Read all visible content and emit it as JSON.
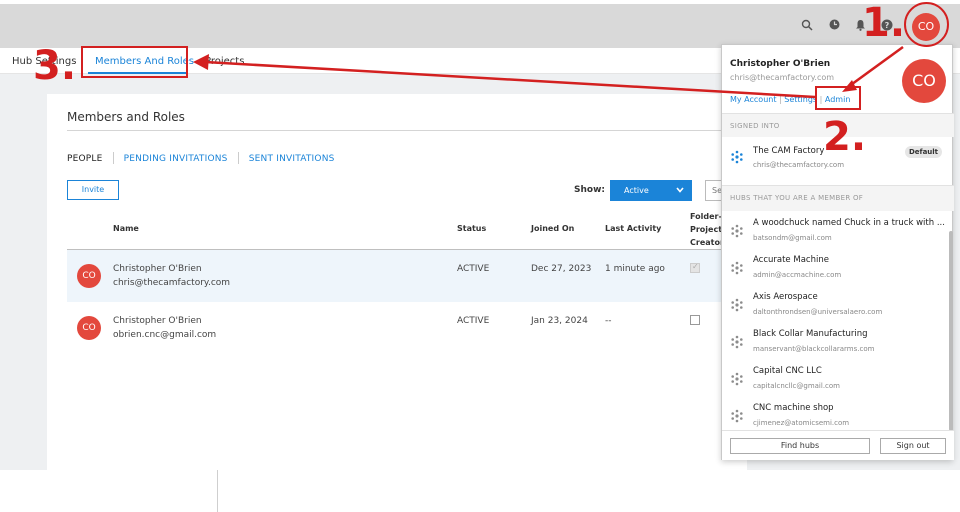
{
  "topbar": {
    "avatar_initials": "CO",
    "icons": [
      "search-icon",
      "clock-icon",
      "bell-icon",
      "help-icon"
    ]
  },
  "subnav": {
    "hub_settings": "Hub Settings",
    "members_and_roles": "Members And Roles",
    "projects": "Projects"
  },
  "page": {
    "title": "Members and Roles",
    "tabs": {
      "people": "PEOPLE",
      "pending": "PENDING INVITATIONS",
      "sent": "SENT INVITATIONS"
    },
    "invite_button": "Invite",
    "show_label": "Show:",
    "show_value": "Active",
    "search_stub": "Se",
    "columns": {
      "name": "Name",
      "status": "Status",
      "joined_on": "Joined On",
      "last_activity": "Last Activity",
      "folder_line1": "Folder-l",
      "folder_line2": "Project",
      "folder_line3": "Creator"
    },
    "rows": [
      {
        "initials": "CO",
        "name": "Christopher O'Brien",
        "email": "chris@thecamfactory.com",
        "status": "ACTIVE",
        "joined": "Dec 27, 2023",
        "last": "1 minute ago"
      },
      {
        "initials": "CO",
        "name": "Christopher O'Brien",
        "email": "obrien.cnc@gmail.com",
        "status": "ACTIVE",
        "joined": "Jan 23, 2024",
        "last": "--"
      }
    ]
  },
  "dropdown": {
    "user_name": "Christopher O'Brien",
    "user_email": "chris@thecamfactory.com",
    "avatar_initials": "CO",
    "links": {
      "my_account": "My Account",
      "settings": "Settings",
      "admin": "Admin"
    },
    "signed_into_label": "SIGNED INTO",
    "signed_hub": {
      "name": "The CAM Factory",
      "email": "chris@thecamfactory.com",
      "badge": "Default"
    },
    "hubs_label": "HUBS THAT YOU ARE A MEMBER OF",
    "hubs": [
      {
        "name": "A woodchuck named Chuck in a truck with ...",
        "email": "batsondm@gmail.com"
      },
      {
        "name": "Accurate Machine",
        "email": "admin@accmachine.com"
      },
      {
        "name": "Axis Aerospace",
        "email": "daltonthrondsen@universalaero.com"
      },
      {
        "name": "Black Collar Manufacturing",
        "email": "manservant@blackcollararms.com"
      },
      {
        "name": "Capital CNC LLC",
        "email": "capitalcncllc@gmail.com"
      },
      {
        "name": "CNC machine shop",
        "email": "cjimenez@atomicsemi.com"
      }
    ],
    "find_hubs": "Find hubs",
    "sign_out": "Sign out"
  },
  "annotations": {
    "one": "1.",
    "two": "2.",
    "three": "3.",
    "color": "#d32020"
  }
}
